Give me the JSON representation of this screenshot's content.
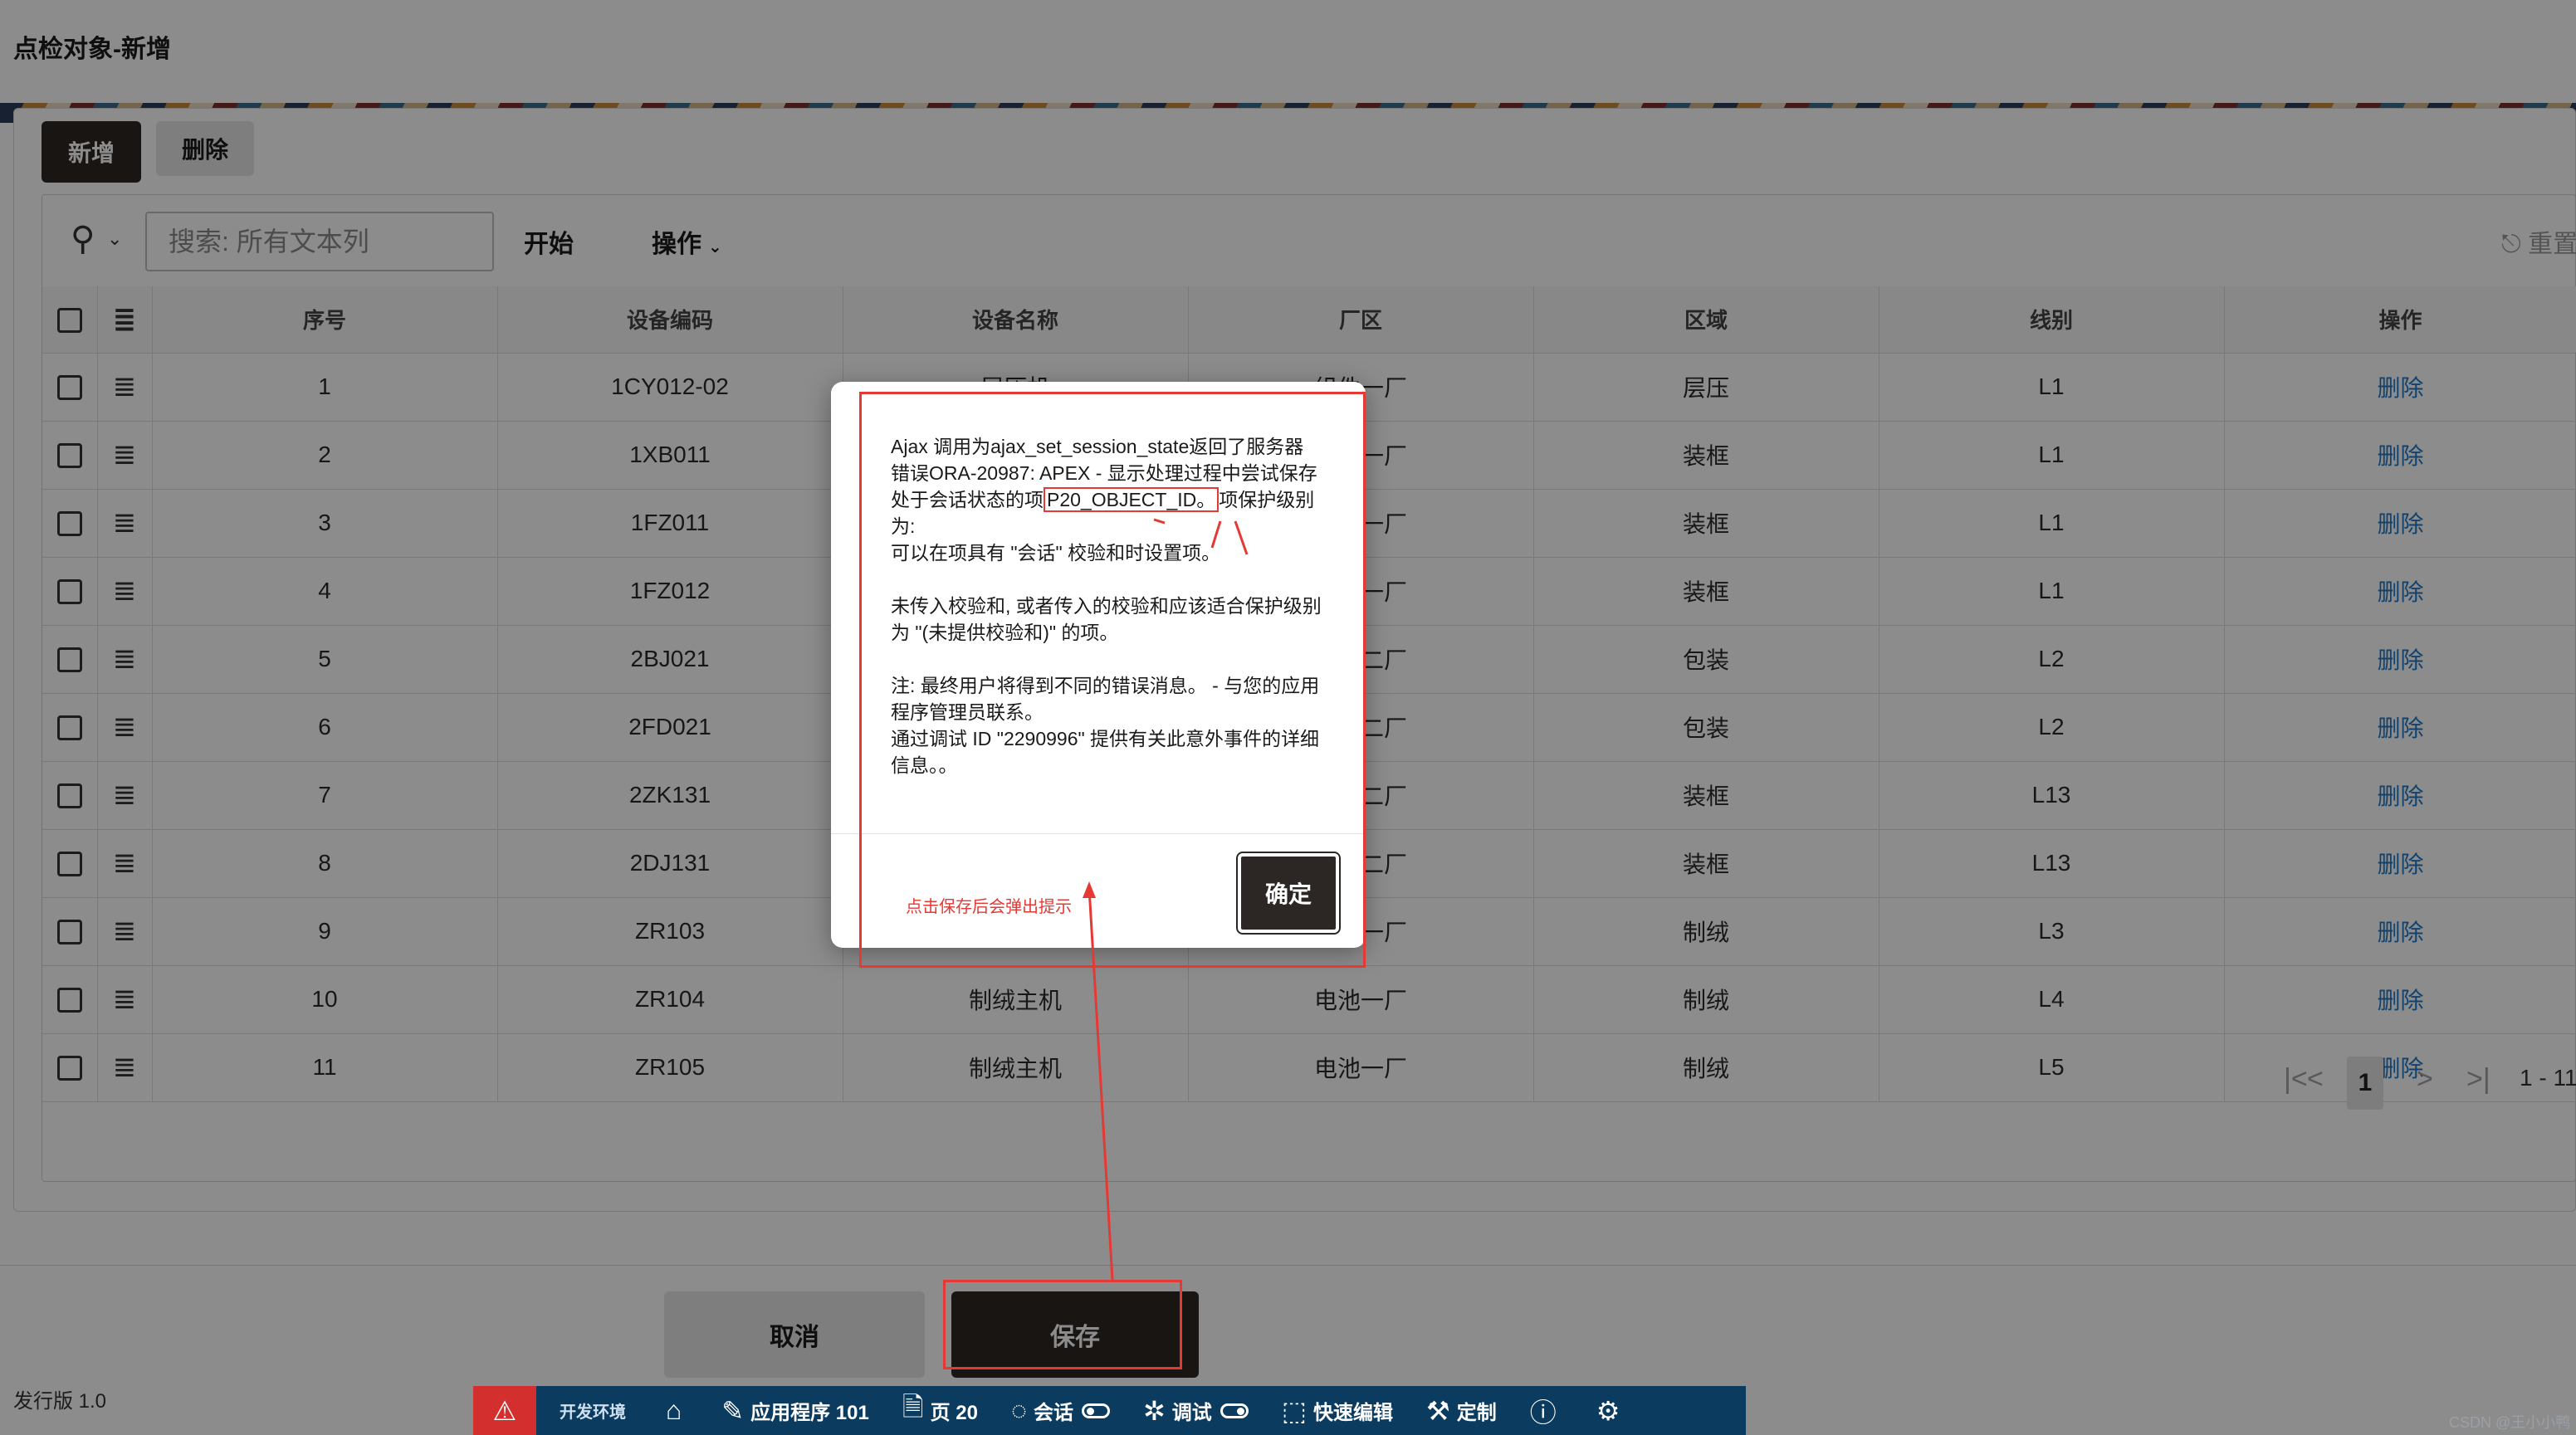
{
  "page": {
    "title": "点检对象-新增",
    "version": "发行版 1.0",
    "watermark": "CSDN @王小小鸭"
  },
  "region": {
    "add_button": "新增",
    "delete_button": "删除"
  },
  "toolbar": {
    "search_placeholder": "搜索: 所有文本列",
    "search_value": "",
    "go_label": "开始",
    "actions_label": "操作",
    "reset_label": "重置"
  },
  "table": {
    "columns": [
      "序号",
      "设备编码",
      "设备名称",
      "厂区",
      "区域",
      "线别",
      "操作"
    ],
    "rows": [
      {
        "seq": "1",
        "code": "1CY012-02",
        "name": "层压机",
        "plant": "组件一厂",
        "area": "层压",
        "line": "L1",
        "action": "删除"
      },
      {
        "seq": "2",
        "code": "1XB011",
        "name": "",
        "plant": "组件一厂",
        "area": "装框",
        "line": "L1",
        "action": "删除"
      },
      {
        "seq": "3",
        "code": "1FZ011",
        "name": "",
        "plant": "组件一厂",
        "area": "装框",
        "line": "L1",
        "action": "删除"
      },
      {
        "seq": "4",
        "code": "1FZ012",
        "name": "",
        "plant": "组件一厂",
        "area": "装框",
        "line": "L1",
        "action": "删除"
      },
      {
        "seq": "5",
        "code": "2BJ021",
        "name": "",
        "plant": "组件二厂",
        "area": "包装",
        "line": "L2",
        "action": "删除"
      },
      {
        "seq": "6",
        "code": "2FD021",
        "name": "",
        "plant": "组件二厂",
        "area": "包装",
        "line": "L2",
        "action": "删除"
      },
      {
        "seq": "7",
        "code": "2ZK131",
        "name": "",
        "plant": "组件二厂",
        "area": "装框",
        "line": "L13",
        "action": "删除"
      },
      {
        "seq": "8",
        "code": "2DJ131",
        "name": "",
        "plant": "组件二厂",
        "area": "装框",
        "line": "L13",
        "action": "删除"
      },
      {
        "seq": "9",
        "code": "ZR103",
        "name": "",
        "plant": "电池一厂",
        "area": "制绒",
        "line": "L3",
        "action": "删除"
      },
      {
        "seq": "10",
        "code": "ZR104",
        "name": "制绒主机",
        "plant": "电池一厂",
        "area": "制绒",
        "line": "L4",
        "action": "删除"
      },
      {
        "seq": "11",
        "code": "ZR105",
        "name": "制绒主机",
        "plant": "电池一厂",
        "area": "制绒",
        "line": "L5",
        "action": "删除"
      }
    ]
  },
  "pagination": {
    "current": "1",
    "range": "1 - 11/"
  },
  "form_buttons": {
    "cancel": "取消",
    "save": "保存"
  },
  "dialog": {
    "para1_before": "Ajax 调用为ajax_set_session_state返回了服务器错误ORA-20987: APEX - 显示处理过程中尝试保存处于会话状态的项",
    "para1_highlight": "P20_OBJECT_ID。",
    "para1_after": "项保护级别为:",
    "para1_line2": "可以在项具有 \"会话\" 校验和时设置项。",
    "para2": "未传入校验和, 或者传入的校验和应该适合保护级别为 \"(未提供校验和)\" 的项。",
    "para3_line1": "注: 最终用户将得到不同的错误消息。 - 与您的应用程序管理员联系。",
    "para3_line2": "通过调试 ID \"2290996\" 提供有关此意外事件的详细信息。。",
    "ok_button": "确定",
    "annotation_note": "点击保存后会弹出提示"
  },
  "devbar": {
    "env": "开发环境",
    "app": "应用程序 101",
    "page": "页 20",
    "session": "会话",
    "debug": "调试",
    "quick_edit": "快速编辑",
    "customize": "定制"
  },
  "colors": {
    "primary_dark": "#2c2724",
    "link_blue": "#1f78c8",
    "annotation_red": "#e53935",
    "devbar_blue": "#0b3b5f",
    "alert_red": "#d32f2f"
  }
}
